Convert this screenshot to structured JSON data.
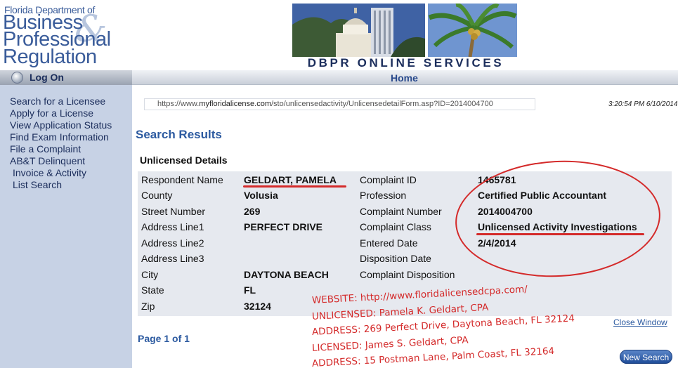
{
  "header": {
    "logo_line1": "Florida Department of",
    "logo_line2": "Business",
    "logo_line3": "Professional",
    "logo_line4": "Regulation",
    "banner_title": "DBPR ONLINE SERVICES",
    "home_label": "Home"
  },
  "logon": {
    "label": "Log On"
  },
  "sidebar": {
    "items": [
      {
        "label": "Search for a Licensee"
      },
      {
        "label": "Apply for a License"
      },
      {
        "label": "View Application Status"
      },
      {
        "label": "Find Exam Information"
      },
      {
        "label": "File a Complaint"
      },
      {
        "label": "AB&T Delinquent"
      },
      {
        "label": "Invoice & Activity"
      },
      {
        "label": "List Search"
      }
    ]
  },
  "browser": {
    "url_prefix": "https://www.",
    "url_domain": "myfloridalicense.com",
    "url_path": "/sto/unlicensedactivity/UnlicensedetailForm.asp?ID=2014004700",
    "timestamp": "3:20:54 PM 6/10/2014"
  },
  "main": {
    "title": "Search Results",
    "section_label": "Unlicensed Details",
    "left_fields": [
      {
        "label": "Respondent Name",
        "value": "GELDART, PAMELA"
      },
      {
        "label": "County",
        "value": "Volusia"
      },
      {
        "label": "Street Number",
        "value": "269"
      },
      {
        "label": "Address Line1",
        "value": "PERFECT DRIVE"
      },
      {
        "label": "Address Line2",
        "value": ""
      },
      {
        "label": "Address Line3",
        "value": ""
      },
      {
        "label": "City",
        "value": "DAYTONA BEACH"
      },
      {
        "label": "State",
        "value": "FL"
      },
      {
        "label": "Zip",
        "value": "32124"
      }
    ],
    "right_fields": [
      {
        "label": "Complaint ID",
        "value": "1465781"
      },
      {
        "label": "Profession",
        "value": "Certified Public Accountant"
      },
      {
        "label": "Complaint Number",
        "value": "2014004700"
      },
      {
        "label": "Complaint Class",
        "value": "Unlicensed Activity Investigations"
      },
      {
        "label": "Entered Date",
        "value": "2/4/2014"
      },
      {
        "label": "Disposition Date",
        "value": ""
      },
      {
        "label": "Complaint Disposition",
        "value": ""
      }
    ],
    "page_info": "Page 1 of 1",
    "close_window": "Close Window",
    "new_search": "New Search"
  },
  "annotations": [
    "WEBSITE:  http://www.floridalicensedcpa.com/",
    "UNLICENSED: Pamela K. Geldart, CPA",
    "ADDRESS: 269 Perfect Drive, Daytona Beach, FL  32124",
    "LICENSED: James S. Geldart, CPA",
    "ADDRESS: 15 Postman Lane, Palm Coast, FL 32164"
  ],
  "colors": {
    "accent_blue": "#2c5aa0",
    "sidebar_bg": "#c7d2e5",
    "annotation_red": "#d42a2a"
  }
}
